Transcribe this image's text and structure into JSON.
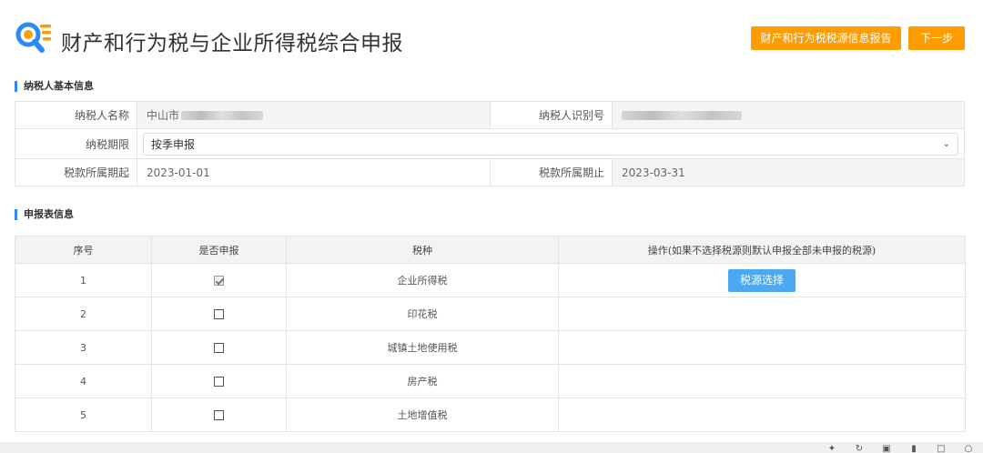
{
  "header": {
    "title": "财产和行为税与企业所得税综合申报",
    "report_button": "财产和行为税税源信息报告",
    "next_button": "下一步"
  },
  "basic_info": {
    "section_title": "纳税人基本信息",
    "taxpayer_name_label": "纳税人名称",
    "taxpayer_name_value": "中山市",
    "taxpayer_id_label": "纳税人识别号",
    "tax_period_label": "纳税期限",
    "tax_period_value": "按季申报",
    "period_start_label": "税款所属期起",
    "period_start_value": "2023-01-01",
    "period_end_label": "税款所属期止",
    "period_end_value": "2023-03-31"
  },
  "declaration": {
    "section_title": "申报表信息",
    "columns": [
      "序号",
      "是否申报",
      "税种",
      "操作(如果不选择税源则默认申报全部未申报的税源)"
    ],
    "rows": [
      {
        "no": "1",
        "checked": true,
        "tax": "企业所得税",
        "action": "税源选择"
      },
      {
        "no": "2",
        "checked": false,
        "tax": "印花税",
        "action": ""
      },
      {
        "no": "3",
        "checked": false,
        "tax": "城镇土地使用税",
        "action": ""
      },
      {
        "no": "4",
        "checked": false,
        "tax": "房产税",
        "action": ""
      },
      {
        "no": "5",
        "checked": false,
        "tax": "土地增值税",
        "action": ""
      }
    ]
  },
  "colors": {
    "accent_orange": "#ff9c00",
    "accent_blue": "#4aa9f5",
    "section_marker": "#2a8cf0"
  },
  "icons": [
    "search-doc-icon",
    "chevron-down-icon",
    "checkbox-icon"
  ]
}
